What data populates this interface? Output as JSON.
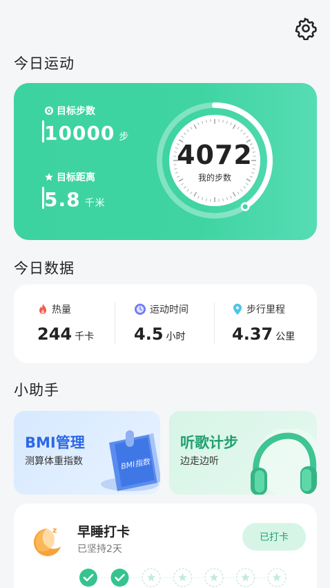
{
  "header": {
    "settings_icon": "gear-icon"
  },
  "today_exercise": {
    "section_title": "今日运动",
    "goal_steps": {
      "label": "目标步数",
      "value": "10000",
      "unit": "步",
      "icon": "target-icon"
    },
    "goal_distance": {
      "label": "目标距离",
      "value": "5.8",
      "unit": "千米",
      "icon": "star-icon"
    },
    "steps": {
      "value": "4072",
      "caption": "我的步数",
      "progress": 0.407
    },
    "colors": {
      "card": "#3fd4a2"
    }
  },
  "today_data": {
    "section_title": "今日数据",
    "metrics": [
      {
        "label": "热量",
        "value": "244",
        "unit": "千卡",
        "icon": "flame-icon"
      },
      {
        "label": "运动时间",
        "value": "4.5",
        "unit": "小时",
        "icon": "clock-icon"
      },
      {
        "label": "步行里程",
        "value": "4.37",
        "unit": "公里",
        "icon": "location-pin-icon"
      }
    ]
  },
  "assistant": {
    "section_title": "小助手",
    "bmi": {
      "title": "BMI管理",
      "subtitle": "测算体重指数",
      "book_label": "BMI指数"
    },
    "music": {
      "title": "听歌计步",
      "subtitle": "边走边听"
    }
  },
  "sleep": {
    "title": "早睡打卡",
    "subtitle": "已坚持2天",
    "button": "已打卡",
    "days_checked": 2,
    "days_total": 7
  }
}
